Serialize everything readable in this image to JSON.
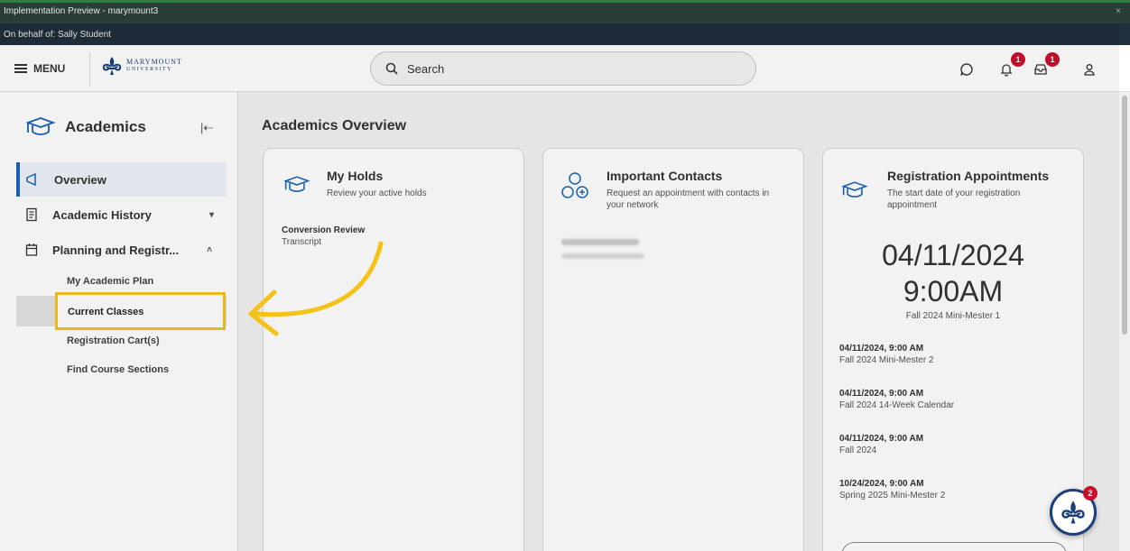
{
  "window": {
    "title": "Implementation Preview - marymount3",
    "on_behalf": "On behalf of: Sally Student",
    "close": "×"
  },
  "header": {
    "menu_label": "MENU",
    "logo_line1": "MARYMOUNT",
    "logo_line2": "UNIVERSITY",
    "search_placeholder": "Search",
    "notifications_count": "1",
    "inbox_count": "1"
  },
  "sidebar": {
    "title": "Academics",
    "items": [
      {
        "label": "Overview"
      },
      {
        "label": "Academic History"
      },
      {
        "label": "Planning and Registr..."
      }
    ],
    "sub_items": [
      {
        "label": "My Academic Plan"
      },
      {
        "label": "Current Classes"
      },
      {
        "label": "Registration Cart(s)"
      },
      {
        "label": "Find Course Sections"
      }
    ]
  },
  "main": {
    "title": "Academics Overview",
    "holds": {
      "title": "My Holds",
      "subtitle": "Review your active holds",
      "hold_name": "Conversion Review",
      "hold_type": "Transcript"
    },
    "contacts": {
      "title": "Important Contacts",
      "subtitle": "Request an appointment with contacts in your network"
    },
    "registration": {
      "title": "Registration Appointments",
      "subtitle": "The start date of your registration appointment",
      "date": "04/11/2024",
      "time": "9:00AM",
      "term": "Fall 2024 Mini-Mester 1",
      "appointments": [
        {
          "when": "04/11/2024, 9:00 AM",
          "term": "Fall 2024 Mini-Mester 2"
        },
        {
          "when": "04/11/2024, 9:00 AM",
          "term": "Fall 2024 14-Week Calendar"
        },
        {
          "when": "04/11/2024, 9:00 AM",
          "term": "Fall 2024"
        },
        {
          "when": "10/24/2024, 9:00 AM",
          "term": "Spring 2025 Mini-Mester 2"
        }
      ]
    }
  },
  "chat": {
    "badge": "2"
  },
  "colors": {
    "accent": "#1a63b8",
    "highlight": "#f5c218",
    "badge": "#c8102e"
  }
}
